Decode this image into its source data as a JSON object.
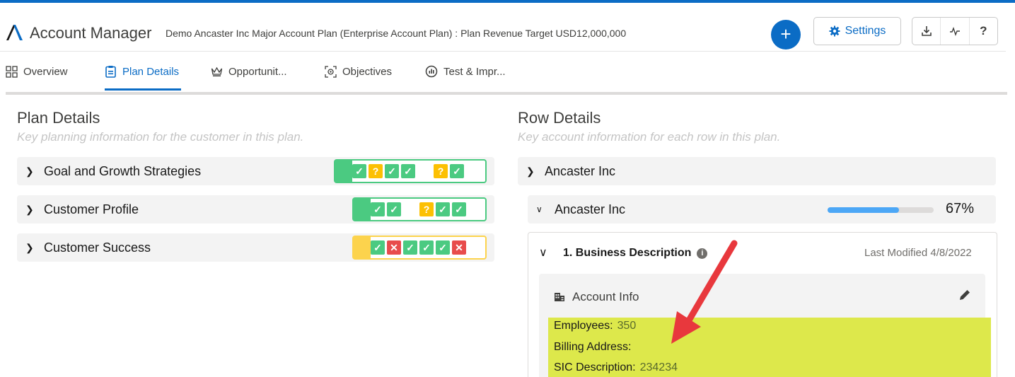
{
  "header": {
    "app_name": "Account Manager",
    "plan_title": "Demo Ancaster Inc Major Account Plan (Enterprise Account Plan) : Plan Revenue Target USD12,000,000",
    "plus_label": "+",
    "settings_label": "Settings",
    "help_label": "?"
  },
  "tabs": [
    {
      "label": "Overview",
      "icon": "grid-icon"
    },
    {
      "label": "Plan Details",
      "icon": "clipboard-icon"
    },
    {
      "label": "Opportunit...",
      "icon": "crown-icon"
    },
    {
      "label": "Objectives",
      "icon": "target-icon"
    },
    {
      "label": "Test & Impr...",
      "icon": "chart-circle-icon"
    }
  ],
  "plan_details": {
    "title": "Plan Details",
    "subtitle": "Key planning information for the customer in this plan.",
    "items": [
      {
        "label": "Goal and Growth Strategies",
        "status": "green",
        "boxes": [
          "ok",
          "q",
          "ok",
          "ok",
          "empty",
          "q",
          "ok"
        ]
      },
      {
        "label": "Customer Profile",
        "status": "green",
        "boxes": [
          "ok",
          "ok",
          "empty",
          "q",
          "ok",
          "ok"
        ]
      },
      {
        "label": "Customer Success",
        "status": "yellow",
        "boxes": [
          "ok",
          "x",
          "ok",
          "ok",
          "ok",
          "x"
        ]
      }
    ]
  },
  "row_details": {
    "title": "Row Details",
    "subtitle": "Key account information for each row in this plan.",
    "rows": [
      {
        "label": "Ancaster Inc",
        "expanded": false
      },
      {
        "label": "Ancaster Inc",
        "expanded": true,
        "progress_percent": 67,
        "progress_label": "67%"
      }
    ],
    "section": {
      "title": "1. Business Description",
      "last_modified": "Last Modified 4/8/2022",
      "panel_title": "Account Info",
      "fields": [
        {
          "label": "Employees:",
          "value": "350"
        },
        {
          "label": "Billing Address:",
          "value": ""
        },
        {
          "label": "SIC Description:",
          "value": "234234"
        }
      ]
    }
  },
  "colors": {
    "brand": "#0b6cc5",
    "ok": "#4bca81",
    "warn": "#fcc003",
    "error": "#e84c4c",
    "highlight": "#dde84b",
    "annotation_arrow": "#e8383d"
  }
}
